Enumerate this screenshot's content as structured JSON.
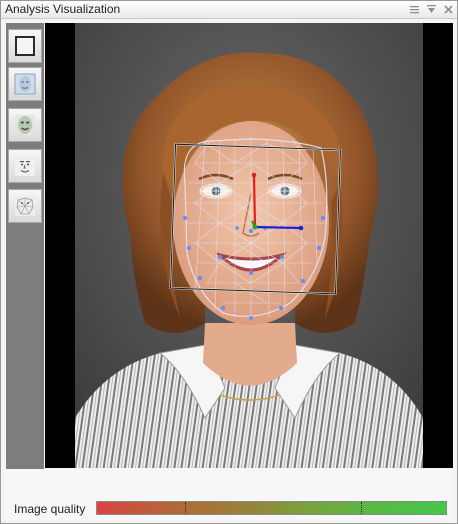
{
  "window": {
    "title": "Analysis Visualization",
    "controls": [
      "menu-icon",
      "pin-icon",
      "close-icon"
    ]
  },
  "toolbar": {
    "tools": [
      {
        "name": "frame-tool",
        "icon": "bounding-box-icon"
      },
      {
        "name": "face-texture-tool",
        "icon": "face-texture-icon"
      },
      {
        "name": "face-model-tool",
        "icon": "face-model-icon"
      },
      {
        "name": "face-sketch-tool",
        "icon": "face-sketch-icon"
      },
      {
        "name": "face-mesh-tool",
        "icon": "face-mesh-icon"
      }
    ]
  },
  "viewport": {
    "image": "portrait-with-face-tracking-mesh",
    "overlay_colors": {
      "mesh": "#e6e6ff",
      "axis_x": "#1e1ee6",
      "axis_y": "#e21f1f",
      "axis_z": "#1fa31f",
      "landmark": "#5a8fff"
    }
  },
  "status": {
    "image_quality_label": "Image quality",
    "image_quality_gradient": [
      "#d94444",
      "#94853a",
      "#45c849"
    ]
  }
}
